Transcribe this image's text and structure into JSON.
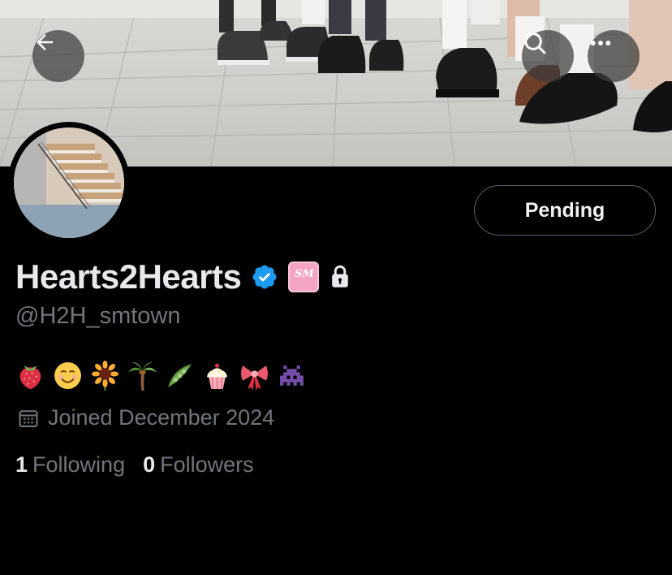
{
  "header": {
    "back_icon": "arrow-left-icon",
    "search_icon": "search-icon",
    "more_icon": "more-dots-icon"
  },
  "profile": {
    "display_name": "Hearts2Hearts",
    "verified_icon": "verified-badge-icon",
    "affiliate_badge": "SM 30",
    "protected_icon": "lock-icon",
    "handle": "@H2H_smtown",
    "bio_emojis": [
      "🍓",
      "😊",
      "🌻",
      "🌴",
      "🫛",
      "🧁",
      "🎀",
      "👾"
    ],
    "joined_icon": "calendar-icon",
    "joined_text": "Joined December 2024",
    "following_count": "1",
    "following_label": "Following",
    "followers_count": "0",
    "followers_label": "Followers",
    "follow_state_label": "Pending"
  },
  "colors": {
    "background": "#000000",
    "primary_text": "#e7e9ea",
    "secondary_text": "#71767b",
    "verified_blue": "#1d9bf0",
    "button_border": "#536471"
  }
}
